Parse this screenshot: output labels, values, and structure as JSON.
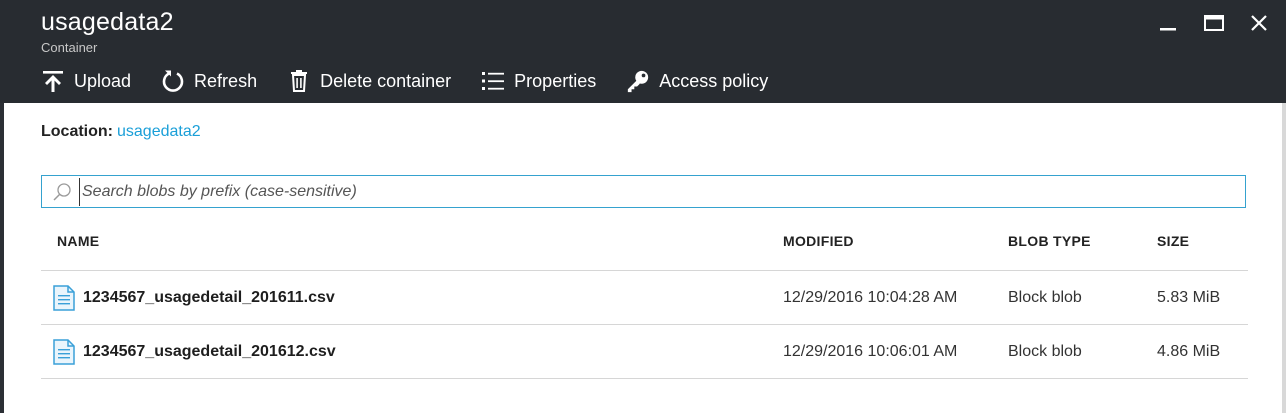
{
  "header": {
    "title": "usagedata2",
    "subtitle": "Container",
    "window_controls": [
      "minimize-icon",
      "maximize-icon",
      "close-icon"
    ]
  },
  "toolbar": {
    "items": [
      {
        "label": "Upload",
        "icon": "upload-icon"
      },
      {
        "label": "Refresh",
        "icon": "refresh-icon"
      },
      {
        "label": "Delete container",
        "icon": "trash-icon"
      },
      {
        "label": "Properties",
        "icon": "list-icon"
      },
      {
        "label": "Access policy",
        "icon": "key-icon"
      }
    ]
  },
  "location": {
    "label": "Location:",
    "value": "usagedata2"
  },
  "search": {
    "placeholder": "Search blobs by prefix (case-sensitive)",
    "value": ""
  },
  "table": {
    "columns": [
      "NAME",
      "MODIFIED",
      "BLOB TYPE",
      "SIZE"
    ],
    "rows": [
      {
        "name": "1234567_usagedetail_201611.csv",
        "modified": "12/29/2016 10:04:28 AM",
        "blob_type": "Block blob",
        "size": "5.83 MiB"
      },
      {
        "name": "1234567_usagedetail_201612.csv",
        "modified": "12/29/2016 10:06:01 AM",
        "blob_type": "Block blob",
        "size": "4.86 MiB"
      }
    ]
  },
  "colors": {
    "header_bg": "#282c31",
    "link": "#1a9fd8",
    "search_border": "#35a2cf",
    "file_icon": "#3aa0d8"
  }
}
